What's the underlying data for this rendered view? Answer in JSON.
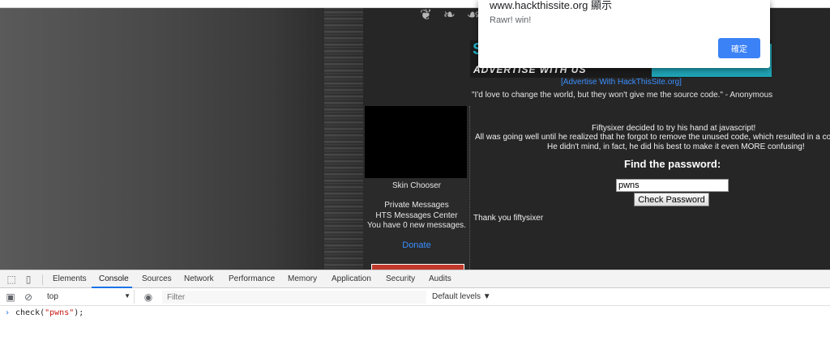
{
  "site": {
    "advertise_title": "ADVERTISE WITH US",
    "advertise_link": "[Advertise With HackThisSite.org]",
    "quote": "\"I'd love to change the world, but they won't give me the source code.\" - Anonymous",
    "sidebar": {
      "skin_chooser": "Skin Chooser",
      "private_messages": "Private Messages",
      "hts_messages_center": "HTS Messages Center",
      "new_messages": "You have 0 new messages.",
      "donate": "Donate"
    },
    "mission": {
      "line1": "Fiftysixer decided to try his hand at javascript!",
      "line2": "All was going well until he realized that he forgot to remove the unused code, which resulted in a confu",
      "line3": "He didn't mind, in fact, he did his best to make it even MORE confusing!",
      "find_title": "Find the password:",
      "password_value": "pwns",
      "check_button": "Check Password",
      "thanks": "Thank you fiftysixer"
    }
  },
  "dialog": {
    "title": "www.hackthissite.org 顯示",
    "message": "Rawr! win!",
    "ok_button": "確定"
  },
  "devtools": {
    "tabs": [
      "Elements",
      "Console",
      "Sources",
      "Network",
      "Performance",
      "Memory",
      "Application",
      "Security",
      "Audits"
    ],
    "active_tab": "Console",
    "context": "top",
    "filter_placeholder": "Filter",
    "levels": "Default levels ▼",
    "console_input": {
      "prefix": "check(",
      "string": "\"pwns\"",
      "suffix": ");"
    }
  },
  "colors": {
    "accent_cyan": "#1fa3b5",
    "link_blue": "#3a8fff",
    "dialog_button": "#3b82f6",
    "devtools_active": "#1a73e8"
  }
}
